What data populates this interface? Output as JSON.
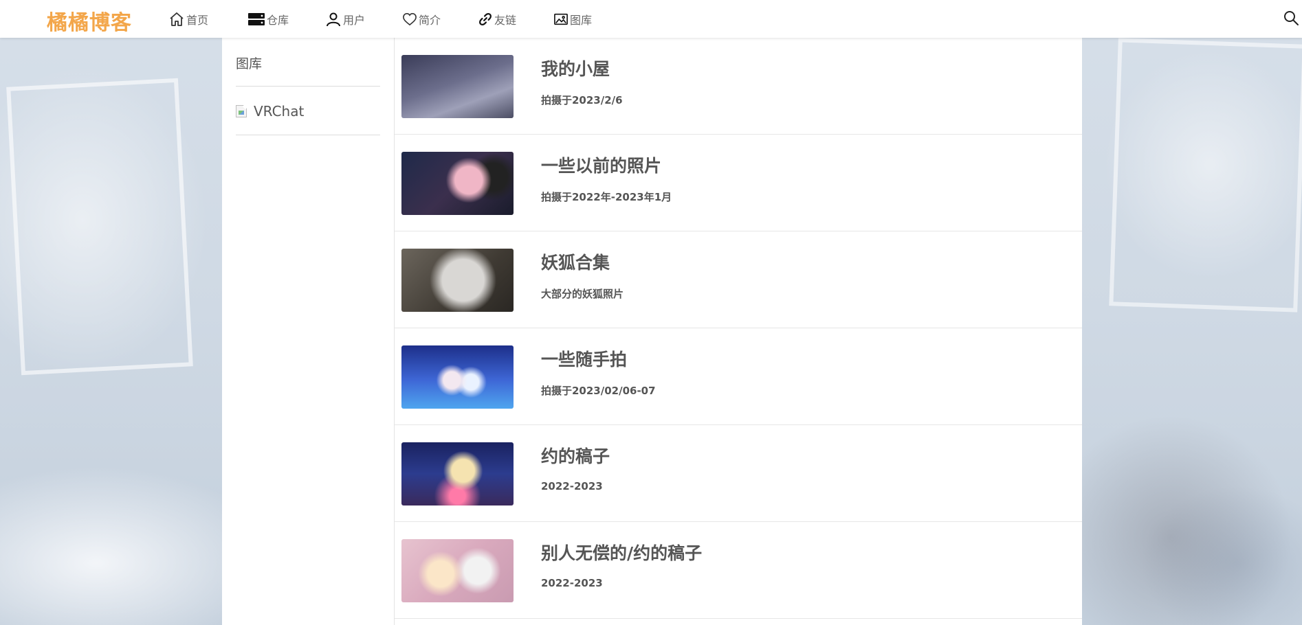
{
  "header": {
    "brand": "橘橘博客",
    "nav": [
      {
        "label": "首页",
        "icon": "home-icon"
      },
      {
        "label": "仓库",
        "icon": "server-icon"
      },
      {
        "label": "用户",
        "icon": "user-icon"
      },
      {
        "label": "简介",
        "icon": "heart-icon"
      },
      {
        "label": "友链",
        "icon": "link-icon"
      },
      {
        "label": "图库",
        "icon": "image-icon"
      }
    ],
    "search_icon": "search-icon"
  },
  "sidebar": {
    "title": "图库",
    "items": [
      {
        "label": "VRChat",
        "icon": "broken-image-icon"
      }
    ]
  },
  "albums": [
    {
      "title": "我的小屋",
      "subtitle": "拍摄于2023/2/6"
    },
    {
      "title": "一些以前的照片",
      "subtitle": "拍摄于2022年-2023年1月"
    },
    {
      "title": "妖狐合集",
      "subtitle": "大部分的妖狐照片"
    },
    {
      "title": "一些随手拍",
      "subtitle": "拍摄于2023/02/06-07"
    },
    {
      "title": "约的稿子",
      "subtitle": "2022-2023"
    },
    {
      "title": "别人无偿的/约的稿子",
      "subtitle": "2022-2023"
    }
  ],
  "colors": {
    "brand": "#f3a64a",
    "text": "#555555",
    "nav_text": "#666666"
  }
}
